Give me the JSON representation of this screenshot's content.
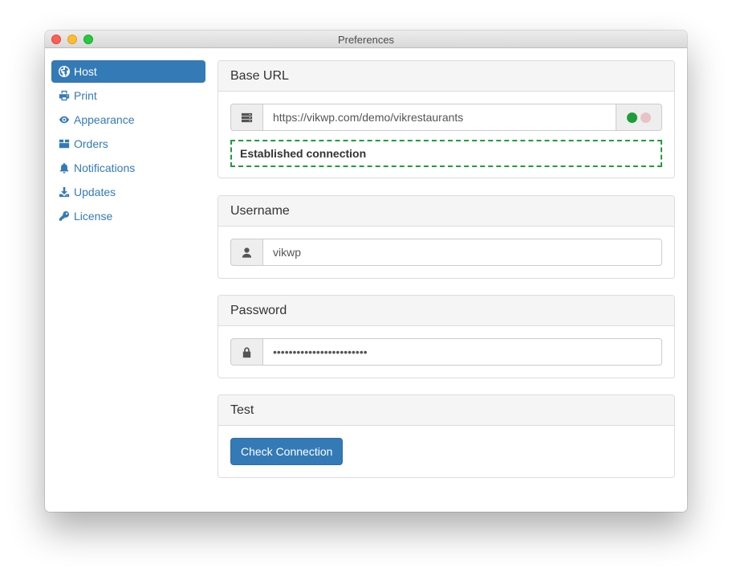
{
  "window": {
    "title": "Preferences"
  },
  "sidebar": {
    "items": [
      {
        "label": "Host",
        "icon": "globe-icon",
        "active": true
      },
      {
        "label": "Print",
        "icon": "printer-icon"
      },
      {
        "label": "Appearance",
        "icon": "eye-icon"
      },
      {
        "label": "Orders",
        "icon": "box-icon"
      },
      {
        "label": "Notifications",
        "icon": "bell-icon"
      },
      {
        "label": "Updates",
        "icon": "download-icon"
      },
      {
        "label": "License",
        "icon": "key-icon"
      }
    ]
  },
  "base_url": {
    "heading": "Base URL",
    "icon": "server-icon",
    "value": "https://vikwp.com/demo/vikrestaurants",
    "status_message": "Established connection",
    "status_colors": {
      "online": "#1e9d3b",
      "offline": "#e8c3c6"
    }
  },
  "username": {
    "heading": "Username",
    "icon": "user-icon",
    "value": "vikwp"
  },
  "password": {
    "heading": "Password",
    "icon": "lock-icon",
    "value": "••••••••••••••••••••••••"
  },
  "test": {
    "heading": "Test",
    "button_label": "Check Connection"
  },
  "colors": {
    "accent": "#337ab7",
    "success_border": "#1e9d3b"
  }
}
